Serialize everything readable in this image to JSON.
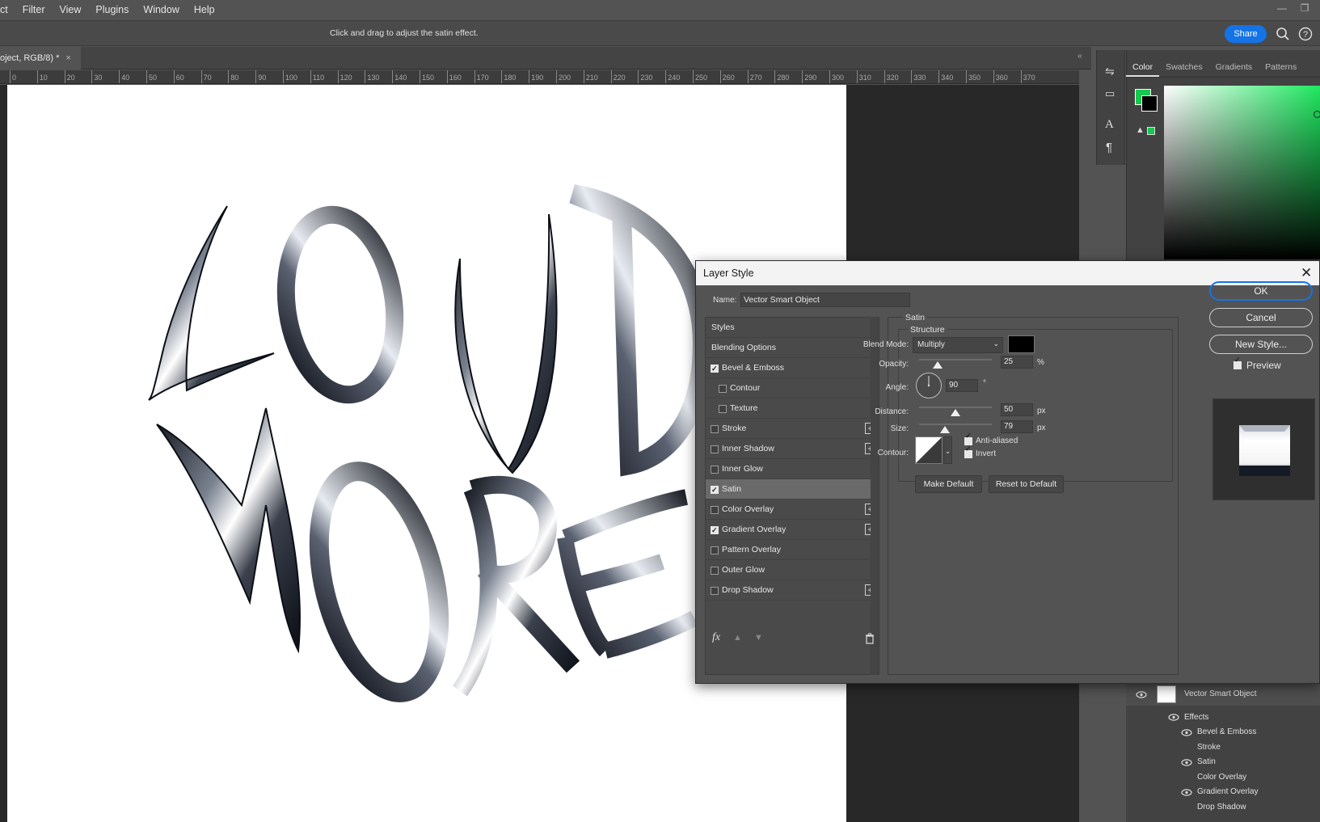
{
  "menu": [
    "ct",
    "Filter",
    "View",
    "Plugins",
    "Window",
    "Help"
  ],
  "options_bar": {
    "hint": "Click and drag to adjust the satin effect.",
    "share_label": "Share"
  },
  "document_tab": {
    "title": "oject, RGB/8) *",
    "close": "×"
  },
  "ruler": {
    "labels": [
      "0",
      "10",
      "20",
      "30",
      "40",
      "50",
      "60",
      "70",
      "80",
      "90",
      "100",
      "110",
      "120",
      "130",
      "140",
      "150",
      "160",
      "170",
      "180",
      "190",
      "200",
      "210",
      "220",
      "230",
      "240",
      "250",
      "260",
      "270",
      "280",
      "290",
      "300",
      "310",
      "320",
      "330",
      "340",
      "350",
      "360",
      "370"
    ]
  },
  "color_panel": {
    "tabs": [
      "Color",
      "Swatches",
      "Gradients",
      "Patterns"
    ],
    "active_tab": "Color",
    "foreground": "#16c84c",
    "background": "#000000"
  },
  "dialog": {
    "title": "Layer Style",
    "name_label": "Name:",
    "name_value": "Vector Smart Object",
    "styles": [
      {
        "label": "Styles",
        "checkbox": false,
        "checked": false,
        "indent": 0,
        "plus": false,
        "selected": false
      },
      {
        "label": "Blending Options",
        "checkbox": false,
        "checked": false,
        "indent": 0,
        "plus": false,
        "selected": false
      },
      {
        "label": "Bevel & Emboss",
        "checkbox": true,
        "checked": true,
        "indent": 0,
        "plus": false,
        "selected": false
      },
      {
        "label": "Contour",
        "checkbox": true,
        "checked": false,
        "indent": 1,
        "plus": false,
        "selected": false
      },
      {
        "label": "Texture",
        "checkbox": true,
        "checked": false,
        "indent": 1,
        "plus": false,
        "selected": false
      },
      {
        "label": "Stroke",
        "checkbox": true,
        "checked": false,
        "indent": 0,
        "plus": true,
        "selected": false
      },
      {
        "label": "Inner Shadow",
        "checkbox": true,
        "checked": false,
        "indent": 0,
        "plus": true,
        "selected": false
      },
      {
        "label": "Inner Glow",
        "checkbox": true,
        "checked": false,
        "indent": 0,
        "plus": false,
        "selected": false
      },
      {
        "label": "Satin",
        "checkbox": true,
        "checked": true,
        "indent": 0,
        "plus": false,
        "selected": true
      },
      {
        "label": "Color Overlay",
        "checkbox": true,
        "checked": false,
        "indent": 0,
        "plus": true,
        "selected": false
      },
      {
        "label": "Gradient Overlay",
        "checkbox": true,
        "checked": true,
        "indent": 0,
        "plus": true,
        "selected": false
      },
      {
        "label": "Pattern Overlay",
        "checkbox": true,
        "checked": false,
        "indent": 0,
        "plus": false,
        "selected": false
      },
      {
        "label": "Outer Glow",
        "checkbox": true,
        "checked": false,
        "indent": 0,
        "plus": false,
        "selected": false
      },
      {
        "label": "Drop Shadow",
        "checkbox": true,
        "checked": false,
        "indent": 0,
        "plus": true,
        "selected": false
      }
    ],
    "satin": {
      "title": "Satin",
      "structure_title": "Structure",
      "blend_mode_label": "Blend Mode:",
      "blend_mode_value": "Multiply",
      "blend_color": "#000000",
      "opacity_label": "Opacity:",
      "opacity_value": "25",
      "opacity_unit": "%",
      "angle_label": "Angle:",
      "angle_value": "90",
      "angle_unit": "°",
      "distance_label": "Distance:",
      "distance_value": "50",
      "distance_unit": "px",
      "size_label": "Size:",
      "size_value": "79",
      "size_unit": "px",
      "contour_label": "Contour:",
      "anti_aliased_label": "Anti-aliased",
      "anti_aliased": true,
      "invert_label": "Invert",
      "invert": true,
      "make_default_label": "Make Default",
      "reset_default_label": "Reset to Default",
      "opacity_fraction": 0.25,
      "distance_fraction": 0.5,
      "size_fraction": 0.36
    },
    "ok_label": "OK",
    "cancel_label": "Cancel",
    "new_style_label": "New Style...",
    "preview_label": "Preview",
    "preview_checked": true
  },
  "layers": {
    "layer_name": "Vector Smart Object",
    "effects_label": "Effects",
    "effects": [
      {
        "label": "Bevel & Emboss",
        "visible": true
      },
      {
        "label": "Stroke",
        "visible": false
      },
      {
        "label": "Satin",
        "visible": true
      },
      {
        "label": "Color Overlay",
        "visible": false
      },
      {
        "label": "Gradient Overlay",
        "visible": true
      },
      {
        "label": "Drop Shadow",
        "visible": false
      }
    ]
  }
}
